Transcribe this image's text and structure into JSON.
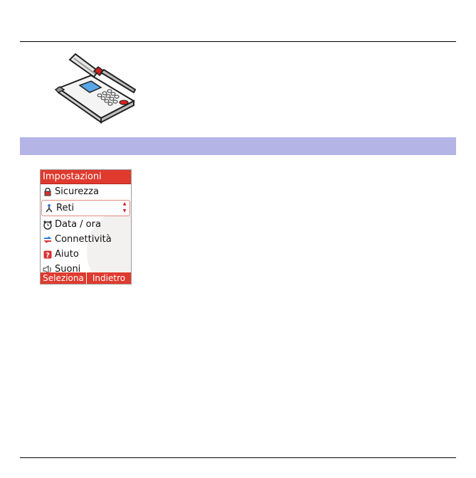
{
  "phone": {
    "title": "Impostazioni",
    "menu": [
      {
        "label": "Sicurezza",
        "icon": "lock-icon"
      },
      {
        "label": "Reti",
        "icon": "network-icon",
        "selected": true
      },
      {
        "label": "Data / ora",
        "icon": "alarm-clock-icon"
      },
      {
        "label": "Connettività",
        "icon": "connectivity-icon"
      },
      {
        "label": "Aiuto",
        "icon": "help-icon"
      },
      {
        "label": "Suoni",
        "icon": "speaker-icon"
      }
    ],
    "softkeys": {
      "left": "Seleziona",
      "right": "Indietro"
    }
  },
  "colors": {
    "band": "#b4b4e6",
    "title_bar": "#e03a2e",
    "softkey_bar": "#e03a2e"
  }
}
